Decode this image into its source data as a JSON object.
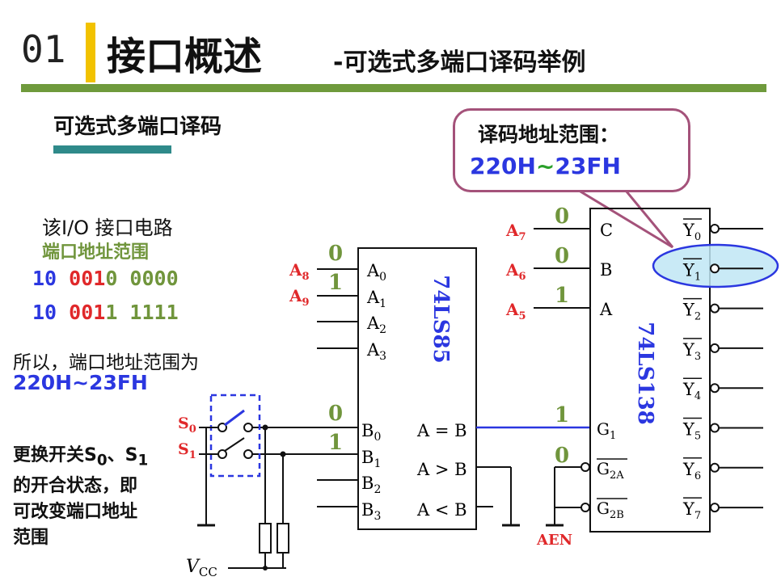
{
  "header": {
    "number": "01",
    "title": "接口概述",
    "subtitle": "-可选式多端口译码举例"
  },
  "section_title": "可选式多端口译码",
  "callout": {
    "title": "译码地址范围：",
    "range_start": "220H",
    "tilde": "~",
    "range_end": "23FH"
  },
  "left": {
    "circuit_label": "该I/O 接口电路",
    "port_range_label": "端口地址范围",
    "addr_rows": [
      {
        "blue": "10 ",
        "red": "001",
        "green_a": "0",
        "rest": " 0000"
      },
      {
        "blue": "10 ",
        "red": "001",
        "green_a": "1",
        "rest": " 1111"
      }
    ],
    "conclusion": "所以，端口地址范围为",
    "conclusion_range": "220H~23FH",
    "switch_note": [
      "更换开关S",
      "0",
      "、S",
      "1",
      "的开合状态，即",
      "可改变端口地址",
      "范围"
    ]
  },
  "chip_85": {
    "name": "74LS85",
    "inputs_a": [
      "A",
      "A",
      "A",
      "A"
    ],
    "inputs_a_sub": [
      "0",
      "1",
      "2",
      "3"
    ],
    "inputs_b": [
      "B",
      "B",
      "B",
      "B"
    ],
    "inputs_b_sub": [
      "0",
      "1",
      "2",
      "3"
    ],
    "outputs": [
      "A = B",
      "A > B",
      "A < B"
    ],
    "addr_labels": [
      "A",
      "A"
    ],
    "addr_subs": [
      "8",
      "9"
    ],
    "a_values": [
      "0",
      "1"
    ],
    "b_values": [
      "0",
      "1"
    ],
    "switches": [
      "S",
      "S"
    ],
    "switch_subs": [
      "0",
      "1"
    ],
    "vcc": "V",
    "vcc_sub": "CC"
  },
  "chip_138": {
    "name": "74LS138",
    "inputs": [
      "C",
      "B",
      "A"
    ],
    "input_addr": [
      "A",
      "A",
      "A"
    ],
    "input_addr_subs": [
      "7",
      "6",
      "5"
    ],
    "input_values": [
      "0",
      "0",
      "1"
    ],
    "enables": [
      "G",
      "G",
      "G"
    ],
    "enable_subs": [
      "1",
      "2A",
      "2B"
    ],
    "enable_values": [
      "1",
      "0"
    ],
    "aen": "AEN",
    "outputs": [
      "Y",
      "Y",
      "Y",
      "Y",
      "Y",
      "Y",
      "Y",
      "Y"
    ],
    "output_subs": [
      "0",
      "1",
      "2",
      "3",
      "4",
      "5",
      "6",
      "7"
    ]
  },
  "colors": {
    "accent_bar": "#f2c200",
    "rule_green": "#6f9a3c",
    "teal_bar": "#2f8a8a",
    "callout_border": "#a4527a",
    "blue": "#2b37e0",
    "red": "#e0282a",
    "green": "#70953c",
    "ellipse_fill": "#bfe6f4"
  }
}
